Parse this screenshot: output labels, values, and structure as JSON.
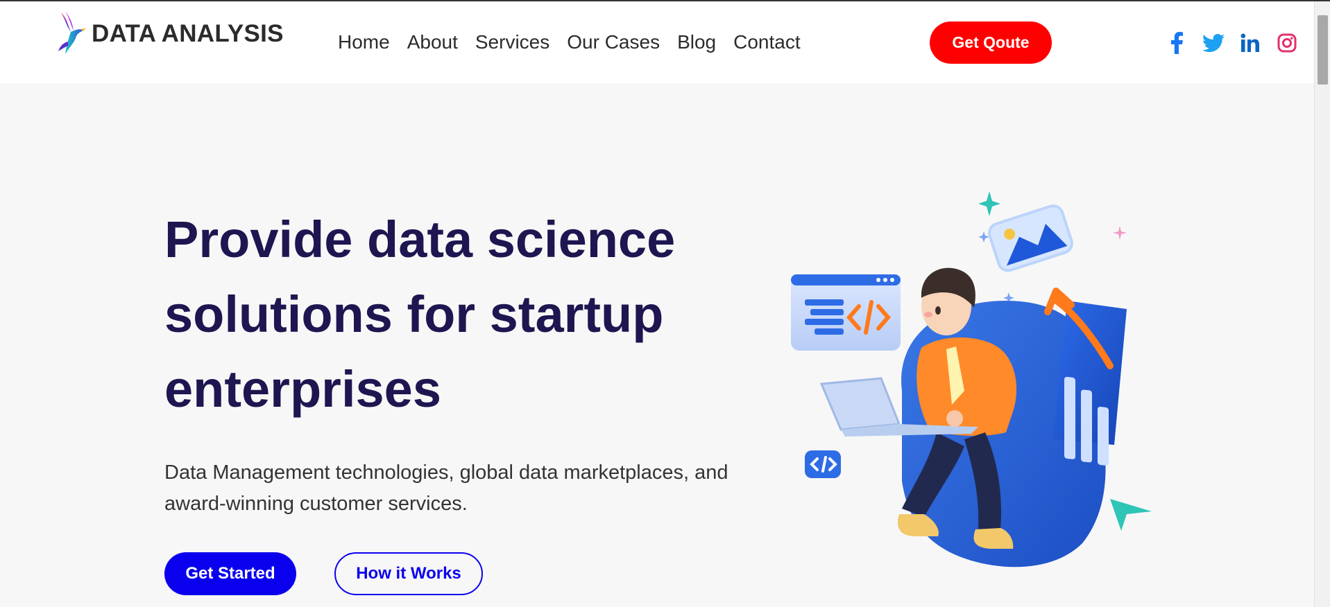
{
  "brand": {
    "name": "DATA ANALYSIS",
    "logo_icon": "bird-logo-icon"
  },
  "nav": {
    "items": [
      {
        "label": "Home"
      },
      {
        "label": "About"
      },
      {
        "label": "Services"
      },
      {
        "label": "Our Cases"
      },
      {
        "label": "Blog"
      },
      {
        "label": "Contact"
      }
    ]
  },
  "header": {
    "quote_label": "Get Qoute"
  },
  "socials": [
    {
      "icon": "facebook-icon",
      "color": "#1877f2"
    },
    {
      "icon": "twitter-icon",
      "color": "#1da1f2"
    },
    {
      "icon": "linkedin-icon",
      "color": "#0a66c2"
    },
    {
      "icon": "instagram-icon",
      "color": "#e1306c"
    }
  ],
  "hero": {
    "title": "Provide data science solutions for startup enterprises",
    "subtitle": "Data Management technologies, global data marketplaces, and award-winning customer services.",
    "primary_label": "Get Started",
    "secondary_label": "How it Works",
    "illustration": "person-with-laptop-data-illustration"
  },
  "colors": {
    "title": "#1d1650",
    "primary": "#0a00ee",
    "quote": "#ff0000",
    "background": "#f7f7f7"
  }
}
